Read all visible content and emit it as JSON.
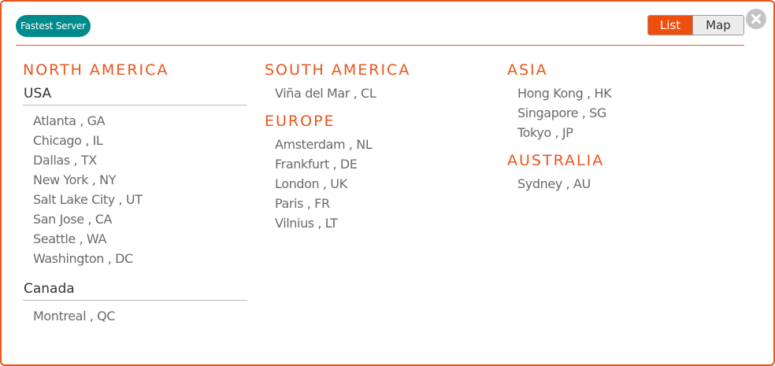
{
  "header": {
    "fastest_label": "Fastest Server",
    "view_toggle": {
      "list_label": "List",
      "map_label": "Map",
      "selected": "List"
    },
    "close_icon": "close-icon"
  },
  "colors": {
    "accent": "#e8561c",
    "toggle_active": "#f04e0c",
    "fastest_button": "#008b8b"
  },
  "regions": {
    "north_america": {
      "name": "NORTH AMERICA",
      "countries": [
        {
          "name": "USA",
          "cities": [
            "Atlanta , GA",
            "Chicago , IL",
            "Dallas , TX",
            "New York , NY",
            "Salt Lake City , UT",
            "San Jose , CA",
            "Seattle , WA",
            "Washington , DC"
          ]
        },
        {
          "name": "Canada",
          "cities": [
            "Montreal , QC"
          ]
        }
      ]
    },
    "south_america": {
      "name": "SOUTH AMERICA",
      "cities": [
        "Viña del Mar , CL"
      ]
    },
    "europe": {
      "name": "EUROPE",
      "cities": [
        "Amsterdam , NL",
        "Frankfurt , DE",
        "London , UK",
        "Paris , FR",
        "Vilnius , LT"
      ]
    },
    "asia": {
      "name": "ASIA",
      "cities": [
        "Hong Kong , HK",
        "Singapore , SG",
        "Tokyo , JP"
      ]
    },
    "australia": {
      "name": "AUSTRALIA",
      "cities": [
        "Sydney , AU"
      ]
    }
  }
}
